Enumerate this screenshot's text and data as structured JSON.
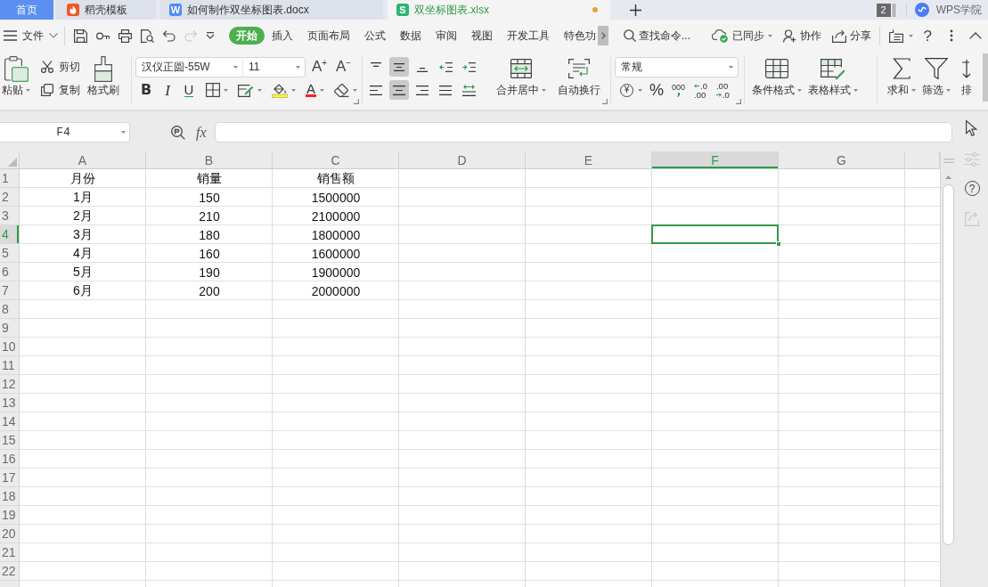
{
  "tab_bar": {
    "tabs": [
      {
        "label": "首页",
        "kind": "home",
        "selected": false,
        "modified": false
      },
      {
        "label": "稻壳模板",
        "kind": "docer",
        "selected": false,
        "modified": false
      },
      {
        "label": "如何制作双坐标图表.docx",
        "kind": "writer",
        "icon_letter": "W",
        "selected": false,
        "modified": false
      },
      {
        "label": "双坐标图表.xlsx",
        "kind": "sheet",
        "icon_letter": "S",
        "selected": true,
        "modified": true
      }
    ],
    "window_count": "2",
    "account": "WPS学院"
  },
  "menu_bar": {
    "file": "文件",
    "quick_access": [
      {
        "kind": "save",
        "disabled": false
      },
      {
        "kind": "key",
        "disabled": false
      },
      {
        "kind": "print",
        "disabled": false
      },
      {
        "kind": "preview",
        "disabled": false
      },
      {
        "kind": "undo",
        "disabled": false
      },
      {
        "kind": "redo",
        "disabled": true
      },
      {
        "kind": "customize",
        "disabled": false
      }
    ],
    "tabs": [
      {
        "label": "开始",
        "selected": true
      },
      {
        "label": "插入",
        "selected": false
      },
      {
        "label": "页面布局",
        "selected": false
      },
      {
        "label": "公式",
        "selected": false
      },
      {
        "label": "数据",
        "selected": false
      },
      {
        "label": "审阅",
        "selected": false
      },
      {
        "label": "视图",
        "selected": false
      },
      {
        "label": "开发工具",
        "selected": false
      },
      {
        "label": "特色功",
        "selected": false
      }
    ],
    "search": {
      "placeholder": "查找命令..."
    },
    "sync": "已同步",
    "collaborate": "协作",
    "share": "分享",
    "help": "?"
  },
  "ribbon": {
    "clipboard": {
      "paste": "粘贴",
      "cut": "剪切",
      "copy": "复制",
      "format_painter": "格式刷"
    },
    "font": {
      "name": "汉仪正圆-55W",
      "size": "11",
      "grow": "A$^{+}$",
      "shrink": "A$^{−}$",
      "bold": "B",
      "italic": "I",
      "underline": "U",
      "font_color": "A"
    },
    "alignment": {
      "vertical": [
        {
          "kind": "top",
          "selected": false
        },
        {
          "kind": "middle",
          "selected": true
        },
        {
          "kind": "bottom",
          "selected": false
        }
      ],
      "horizontal": [
        {
          "kind": "left",
          "selected": false
        },
        {
          "kind": "center",
          "selected": true
        },
        {
          "kind": "right",
          "selected": false
        },
        {
          "kind": "justify",
          "selected": false
        },
        {
          "kind": "distributed",
          "selected": false
        }
      ],
      "merge": "合并居中",
      "wrap": "自动换行"
    },
    "number": {
      "format": "常规",
      "currency": "¥",
      "percent": "%",
      "thousands": "000",
      "add_decimal": [
        ".0",
        ".00"
      ],
      "remove_decimal": [
        ".00",
        ".0"
      ]
    },
    "styles": {
      "conditional_format": "条件格式",
      "table_style": "表格样式"
    },
    "editing": {
      "sum": "求和",
      "filter": "筛选",
      "sort": "排"
    }
  },
  "formula_bar": {
    "cell_reference": "F4",
    "function_label": "fx"
  },
  "side_panel": [
    {
      "kind": "select",
      "disabled": false
    },
    {
      "kind": "properties",
      "disabled": true
    },
    {
      "kind": "help",
      "label": "?",
      "disabled": false
    },
    {
      "kind": "share",
      "disabled": true
    }
  ],
  "sheet": {
    "columns": [
      {
        "label": "A",
        "selected": false
      },
      {
        "label": "B",
        "selected": false
      },
      {
        "label": "C",
        "selected": false
      },
      {
        "label": "D",
        "selected": false
      },
      {
        "label": "E",
        "selected": false
      },
      {
        "label": "F",
        "selected": true
      },
      {
        "label": "G",
        "selected": false
      }
    ],
    "rows": [
      {
        "label": "1",
        "selected": false,
        "cells": [
          "月份",
          "销量",
          "销售额"
        ]
      },
      {
        "label": "2",
        "selected": false,
        "cells": [
          "1月",
          "150",
          "1500000"
        ]
      },
      {
        "label": "3",
        "selected": false,
        "cells": [
          "2月",
          "210",
          "2100000"
        ]
      },
      {
        "label": "4",
        "selected": true,
        "cells": [
          "3月",
          "180",
          "1800000"
        ]
      },
      {
        "label": "5",
        "selected": false,
        "cells": [
          "4月",
          "160",
          "1600000"
        ]
      },
      {
        "label": "6",
        "selected": false,
        "cells": [
          "5月",
          "190",
          "1900000"
        ]
      },
      {
        "label": "7",
        "selected": false,
        "cells": [
          "6月",
          "200",
          "2000000"
        ]
      },
      {
        "label": "8",
        "selected": false
      },
      {
        "label": "9",
        "selected": false
      },
      {
        "label": "10",
        "selected": false
      },
      {
        "label": "11",
        "selected": false
      },
      {
        "label": "12",
        "selected": false
      },
      {
        "label": "13",
        "selected": false
      },
      {
        "label": "14",
        "selected": false
      },
      {
        "label": "15",
        "selected": false
      },
      {
        "label": "16",
        "selected": false
      },
      {
        "label": "17",
        "selected": false
      },
      {
        "label": "18",
        "selected": false
      },
      {
        "label": "19",
        "selected": false
      },
      {
        "label": "20",
        "selected": false
      },
      {
        "label": "21",
        "selected": false
      },
      {
        "label": "22",
        "selected": false
      }
    ]
  }
}
